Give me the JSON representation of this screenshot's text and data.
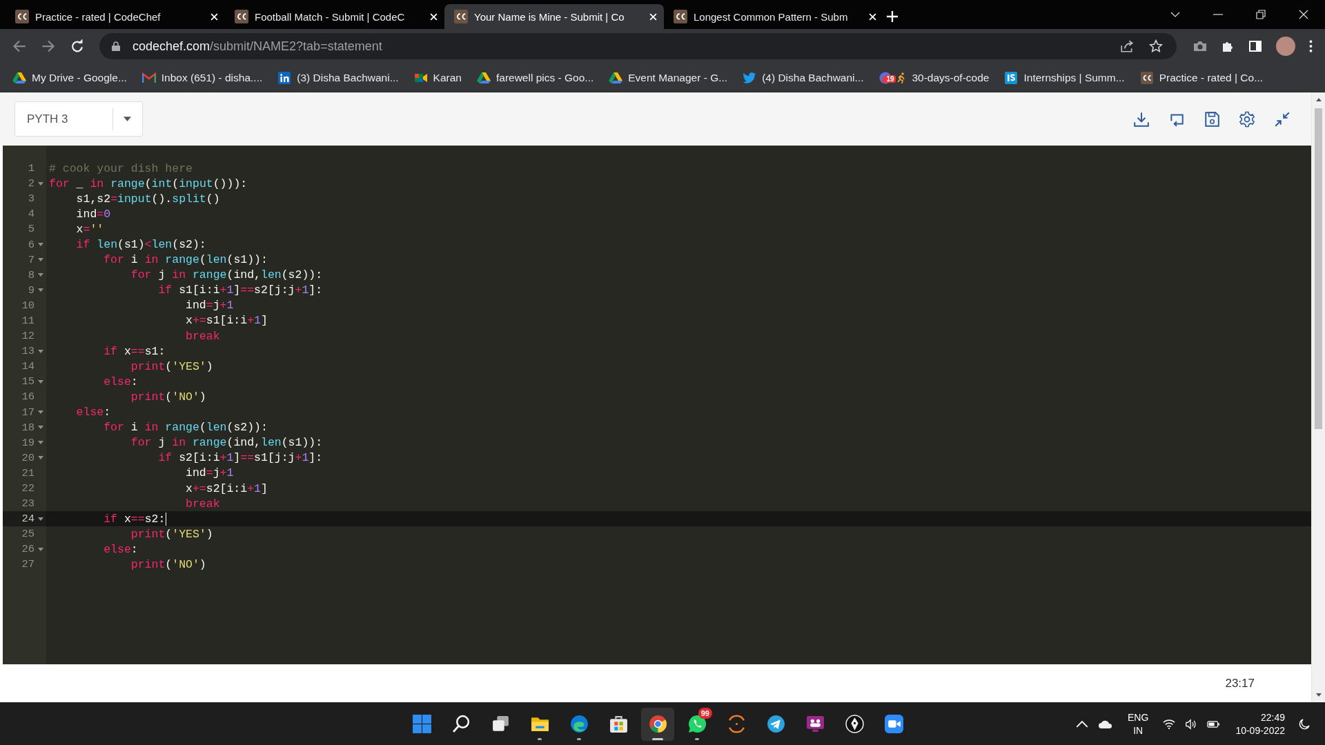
{
  "browser": {
    "tabs": [
      {
        "title": "Practice - rated | CodeChef",
        "selected": false
      },
      {
        "title": "Football Match - Submit | CodeC",
        "selected": false
      },
      {
        "title": "Your Name is Mine - Submit | Co",
        "selected": true
      },
      {
        "title": "Longest Common Pattern - Subm",
        "selected": false
      }
    ],
    "url": {
      "host": "codechef.com",
      "path": "/submit/NAME2?tab=statement"
    },
    "bookmarks": [
      {
        "kind": "drive",
        "label": "My Drive - Google..."
      },
      {
        "kind": "gmail",
        "label": "Inbox (651) - disha...."
      },
      {
        "kind": "linkedin",
        "label": "(3) Disha Bachwani..."
      },
      {
        "kind": "meet",
        "label": "Karan"
      },
      {
        "kind": "drive",
        "label": "farewell pics - Goo..."
      },
      {
        "kind": "drive",
        "label": "Event Manager - G..."
      },
      {
        "kind": "twitter",
        "label": "(4) Disha Bachwani..."
      },
      {
        "kind": "calendar",
        "label": "30-days-of-code",
        "badge": "19"
      },
      {
        "kind": "internshala",
        "label": "Internships | Summ..."
      },
      {
        "kind": "codechef",
        "label": "Practice - rated | Co..."
      }
    ]
  },
  "editor": {
    "language": "PYTH 3",
    "cursor_position": "23:17",
    "lines": [
      {
        "num": "1",
        "foldable": false,
        "current": false,
        "tokens": [
          {
            "text": "# cook your dish here",
            "kind": "cm"
          }
        ]
      },
      {
        "num": "2",
        "foldable": true,
        "current": false,
        "tokens": [
          {
            "text": "for",
            "kind": "kw"
          },
          {
            "text": " _ ",
            "kind": "id"
          },
          {
            "text": "in",
            "kind": "kw"
          },
          {
            "text": " range",
            "kind": "fn"
          },
          {
            "text": "(",
            "kind": "id"
          },
          {
            "text": "int",
            "kind": "fn"
          },
          {
            "text": "(",
            "kind": "id"
          },
          {
            "text": "input",
            "kind": "fn"
          },
          {
            "text": "())):",
            "kind": "id"
          }
        ]
      },
      {
        "num": "3",
        "foldable": false,
        "current": false,
        "tokens": [
          {
            "text": "    s1,s2",
            "kind": "id"
          },
          {
            "text": "=",
            "kind": "op"
          },
          {
            "text": "input",
            "kind": "fn"
          },
          {
            "text": "().",
            "kind": "id"
          },
          {
            "text": "split",
            "kind": "fn"
          },
          {
            "text": "()",
            "kind": "id"
          }
        ]
      },
      {
        "num": "4",
        "foldable": false,
        "current": false,
        "tokens": [
          {
            "text": "    ind",
            "kind": "id"
          },
          {
            "text": "=",
            "kind": "op"
          },
          {
            "text": "0",
            "kind": "num"
          }
        ]
      },
      {
        "num": "5",
        "foldable": false,
        "current": false,
        "tokens": [
          {
            "text": "    x",
            "kind": "id"
          },
          {
            "text": "=",
            "kind": "op"
          },
          {
            "text": "''",
            "kind": "str"
          }
        ]
      },
      {
        "num": "6",
        "foldable": true,
        "current": false,
        "tokens": [
          {
            "text": "    if",
            "kind": "kw"
          },
          {
            "text": " len",
            "kind": "fn"
          },
          {
            "text": "(s1)",
            "kind": "id"
          },
          {
            "text": "<",
            "kind": "op"
          },
          {
            "text": "len",
            "kind": "fn"
          },
          {
            "text": "(s2):",
            "kind": "id"
          }
        ]
      },
      {
        "num": "7",
        "foldable": true,
        "current": false,
        "tokens": [
          {
            "text": "        for",
            "kind": "kw"
          },
          {
            "text": " i ",
            "kind": "id"
          },
          {
            "text": "in",
            "kind": "kw"
          },
          {
            "text": " range",
            "kind": "fn"
          },
          {
            "text": "(",
            "kind": "id"
          },
          {
            "text": "len",
            "kind": "fn"
          },
          {
            "text": "(s1)):",
            "kind": "id"
          }
        ]
      },
      {
        "num": "8",
        "foldable": true,
        "current": false,
        "tokens": [
          {
            "text": "            for",
            "kind": "kw"
          },
          {
            "text": " j ",
            "kind": "id"
          },
          {
            "text": "in",
            "kind": "kw"
          },
          {
            "text": " range",
            "kind": "fn"
          },
          {
            "text": "(ind,",
            "kind": "id"
          },
          {
            "text": "len",
            "kind": "fn"
          },
          {
            "text": "(s2)):",
            "kind": "id"
          }
        ]
      },
      {
        "num": "9",
        "foldable": true,
        "current": false,
        "tokens": [
          {
            "text": "                if",
            "kind": "kw"
          },
          {
            "text": " s1[i:i",
            "kind": "id"
          },
          {
            "text": "+",
            "kind": "op"
          },
          {
            "text": "1",
            "kind": "num"
          },
          {
            "text": "]",
            "kind": "id"
          },
          {
            "text": "==",
            "kind": "op"
          },
          {
            "text": "s2[j:j",
            "kind": "id"
          },
          {
            "text": "+",
            "kind": "op"
          },
          {
            "text": "1",
            "kind": "num"
          },
          {
            "text": "]:",
            "kind": "id"
          }
        ]
      },
      {
        "num": "10",
        "foldable": false,
        "current": false,
        "tokens": [
          {
            "text": "                    ind",
            "kind": "id"
          },
          {
            "text": "=",
            "kind": "op"
          },
          {
            "text": "j",
            "kind": "id"
          },
          {
            "text": "+",
            "kind": "op"
          },
          {
            "text": "1",
            "kind": "num"
          }
        ]
      },
      {
        "num": "11",
        "foldable": false,
        "current": false,
        "tokens": [
          {
            "text": "                    x",
            "kind": "id"
          },
          {
            "text": "+=",
            "kind": "op"
          },
          {
            "text": "s1[i:i",
            "kind": "id"
          },
          {
            "text": "+",
            "kind": "op"
          },
          {
            "text": "1",
            "kind": "num"
          },
          {
            "text": "]",
            "kind": "id"
          }
        ]
      },
      {
        "num": "12",
        "foldable": false,
        "current": false,
        "tokens": [
          {
            "text": "                    break",
            "kind": "kw"
          }
        ]
      },
      {
        "num": "13",
        "foldable": true,
        "current": false,
        "tokens": [
          {
            "text": "        if",
            "kind": "kw"
          },
          {
            "text": " x",
            "kind": "id"
          },
          {
            "text": "==",
            "kind": "op"
          },
          {
            "text": "s1:",
            "kind": "id"
          }
        ]
      },
      {
        "num": "14",
        "foldable": false,
        "current": false,
        "tokens": [
          {
            "text": "            print",
            "kind": "kw"
          },
          {
            "text": "(",
            "kind": "id"
          },
          {
            "text": "'YES'",
            "kind": "str"
          },
          {
            "text": ")",
            "kind": "id"
          }
        ]
      },
      {
        "num": "15",
        "foldable": true,
        "current": false,
        "tokens": [
          {
            "text": "        else",
            "kind": "kw"
          },
          {
            "text": ":",
            "kind": "id"
          }
        ]
      },
      {
        "num": "16",
        "foldable": false,
        "current": false,
        "tokens": [
          {
            "text": "            print",
            "kind": "kw"
          },
          {
            "text": "(",
            "kind": "id"
          },
          {
            "text": "'NO'",
            "kind": "str"
          },
          {
            "text": ")",
            "kind": "id"
          }
        ]
      },
      {
        "num": "17",
        "foldable": true,
        "current": false,
        "tokens": [
          {
            "text": "    else",
            "kind": "kw"
          },
          {
            "text": ":",
            "kind": "id"
          }
        ]
      },
      {
        "num": "18",
        "foldable": true,
        "current": false,
        "tokens": [
          {
            "text": "        for",
            "kind": "kw"
          },
          {
            "text": " i ",
            "kind": "id"
          },
          {
            "text": "in",
            "kind": "kw"
          },
          {
            "text": " range",
            "kind": "fn"
          },
          {
            "text": "(",
            "kind": "id"
          },
          {
            "text": "len",
            "kind": "fn"
          },
          {
            "text": "(s2)):",
            "kind": "id"
          }
        ]
      },
      {
        "num": "19",
        "foldable": true,
        "current": false,
        "tokens": [
          {
            "text": "            for",
            "kind": "kw"
          },
          {
            "text": " j ",
            "kind": "id"
          },
          {
            "text": "in",
            "kind": "kw"
          },
          {
            "text": " range",
            "kind": "fn"
          },
          {
            "text": "(ind,",
            "kind": "id"
          },
          {
            "text": "len",
            "kind": "fn"
          },
          {
            "text": "(s1)):",
            "kind": "id"
          }
        ]
      },
      {
        "num": "20",
        "foldable": true,
        "current": false,
        "tokens": [
          {
            "text": "                if",
            "kind": "kw"
          },
          {
            "text": " s2[i:i",
            "kind": "id"
          },
          {
            "text": "+",
            "kind": "op"
          },
          {
            "text": "1",
            "kind": "num"
          },
          {
            "text": "]",
            "kind": "id"
          },
          {
            "text": "==",
            "kind": "op"
          },
          {
            "text": "s1[j:j",
            "kind": "id"
          },
          {
            "text": "+",
            "kind": "op"
          },
          {
            "text": "1",
            "kind": "num"
          },
          {
            "text": "]:",
            "kind": "id"
          }
        ]
      },
      {
        "num": "21",
        "foldable": false,
        "current": false,
        "tokens": [
          {
            "text": "                    ind",
            "kind": "id"
          },
          {
            "text": "=",
            "kind": "op"
          },
          {
            "text": "j",
            "kind": "id"
          },
          {
            "text": "+",
            "kind": "op"
          },
          {
            "text": "1",
            "kind": "num"
          }
        ]
      },
      {
        "num": "22",
        "foldable": false,
        "current": false,
        "tokens": [
          {
            "text": "                    x",
            "kind": "id"
          },
          {
            "text": "+=",
            "kind": "op"
          },
          {
            "text": "s2[i:i",
            "kind": "id"
          },
          {
            "text": "+",
            "kind": "op"
          },
          {
            "text": "1",
            "kind": "num"
          },
          {
            "text": "]",
            "kind": "id"
          }
        ]
      },
      {
        "num": "23",
        "foldable": false,
        "current": false,
        "tokens": [
          {
            "text": "                    break",
            "kind": "kw"
          }
        ]
      },
      {
        "num": "24",
        "foldable": true,
        "current": true,
        "tokens": [
          {
            "text": "        if",
            "kind": "kw"
          },
          {
            "text": " x",
            "kind": "id"
          },
          {
            "text": "==",
            "kind": "op"
          },
          {
            "text": "s2:",
            "kind": "id"
          }
        ]
      },
      {
        "num": "25",
        "foldable": false,
        "current": false,
        "tokens": [
          {
            "text": "            print",
            "kind": "kw"
          },
          {
            "text": "(",
            "kind": "id"
          },
          {
            "text": "'YES'",
            "kind": "str"
          },
          {
            "text": ")",
            "kind": "id"
          }
        ]
      },
      {
        "num": "26",
        "foldable": true,
        "current": false,
        "tokens": [
          {
            "text": "        else",
            "kind": "kw"
          },
          {
            "text": ":",
            "kind": "id"
          }
        ]
      },
      {
        "num": "27",
        "foldable": false,
        "current": false,
        "tokens": [
          {
            "text": "            print",
            "kind": "kw"
          },
          {
            "text": "(",
            "kind": "id"
          },
          {
            "text": "'NO'",
            "kind": "str"
          },
          {
            "text": ")",
            "kind": "id"
          }
        ]
      }
    ]
  },
  "taskbar": {
    "apps": [
      {
        "kind": "start",
        "running": false,
        "active": false
      },
      {
        "kind": "search",
        "running": false,
        "active": false
      },
      {
        "kind": "taskview",
        "running": false,
        "active": false
      },
      {
        "kind": "folder",
        "running": true,
        "active": false
      },
      {
        "kind": "edge",
        "running": true,
        "active": false
      },
      {
        "kind": "store",
        "running": false,
        "active": false
      },
      {
        "kind": "chrome",
        "running": true,
        "active": true
      },
      {
        "kind": "whatsapp",
        "running": true,
        "active": false,
        "badge": "99"
      },
      {
        "kind": "arc",
        "running": false,
        "active": false
      },
      {
        "kind": "telegram",
        "running": false,
        "active": false
      },
      {
        "kind": "teams",
        "running": false,
        "active": false
      },
      {
        "kind": "pen",
        "running": false,
        "active": false
      },
      {
        "kind": "zoom",
        "running": false,
        "active": false
      }
    ],
    "language": "ENG",
    "region": "IN",
    "time": "22:49",
    "date": "10-09-2022"
  }
}
